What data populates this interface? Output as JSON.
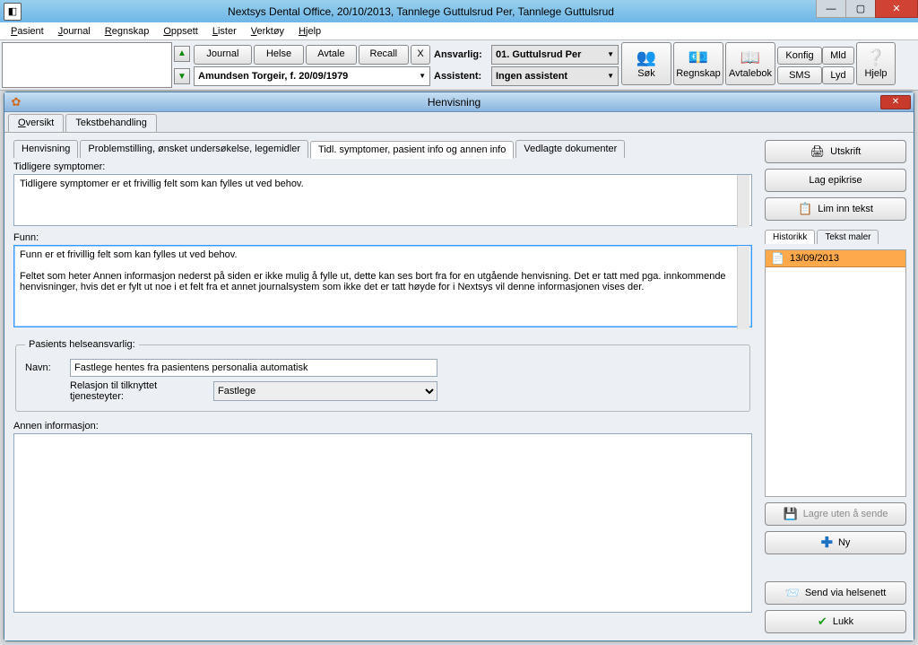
{
  "window": {
    "title": "Nextsys Dental Office,  20/10/2013, Tannlege Guttulsrud Per,  Tannlege Guttulsrud"
  },
  "menus": {
    "pasient": "Pasient",
    "journal": "Journal",
    "regnskap": "Regnskap",
    "oppsett": "Oppsett",
    "lister": "Lister",
    "verktoy": "Verktøy",
    "hjelp": "Hjelp"
  },
  "toolbar": {
    "journal": "Journal",
    "helse": "Helse",
    "avtale": "Avtale",
    "recall": "Recall",
    "x": "X",
    "patient_combo": "Amundsen Torgeir, f. 20/09/1979",
    "ansvarlig_label": "Ansvarlig:",
    "ansvarlig_value": "01. Guttulsrud Per",
    "assistent_label": "Assistent:",
    "assistent_value": "Ingen assistent",
    "sok": "Søk",
    "regnskap_btn": "Regnskap",
    "avtalebok": "Avtalebok",
    "konfig": "Konfig",
    "mld": "Mld",
    "sms": "SMS",
    "lyd": "Lyd",
    "hjelp": "Hjelp"
  },
  "inner": {
    "title": "Henvisning",
    "toptabs": {
      "oversikt": "Oversikt",
      "tekst": "Tekstbehandling"
    },
    "subtabs": {
      "a": "Henvisning",
      "b": "Problemstilling, ønsket undersøkelse, legemidler",
      "c": "Tidl. symptomer, pasient info og annen info",
      "d": "Vedlagte dokumenter"
    },
    "labels": {
      "tidligere": "Tidligere symptomer:",
      "funn": "Funn:",
      "grp": "Pasients helseansvarlig:",
      "navn": "Navn:",
      "relasjon": "Relasjon til tilknyttet tjenesteyter:",
      "annen": "Annen informasjon:"
    },
    "values": {
      "tidligere": "Tidligere symptomer er et frivillig felt som kan fylles ut ved behov.",
      "funn": "Funn er et frivillig felt som kan fylles ut ved behov.\n\nFeltet som heter Annen informasjon nederst på siden er ikke mulig å fylle ut, dette kan ses bort fra for en utgående henvisning. Det er tatt med pga. innkommende henvisninger, hvis det er fylt ut noe i et felt fra et annet journalsystem som ikke det er tatt høyde for i Nextsys vil denne informasjonen vises der.",
      "navn": "Fastlege hentes fra pasientens personalia automatisk",
      "relasjon": "Fastlege",
      "annen": ""
    }
  },
  "side": {
    "utskrift": "Utskrift",
    "epikrise": "Lag epikrise",
    "liminn": "Lim inn tekst",
    "tab_hist": "Historikk",
    "tab_maler": "Tekst maler",
    "history_item": "13/09/2013",
    "lagre": "Lagre uten å sende",
    "ny": "Ny",
    "send": "Send via helsenett",
    "lukk": "Lukk"
  }
}
